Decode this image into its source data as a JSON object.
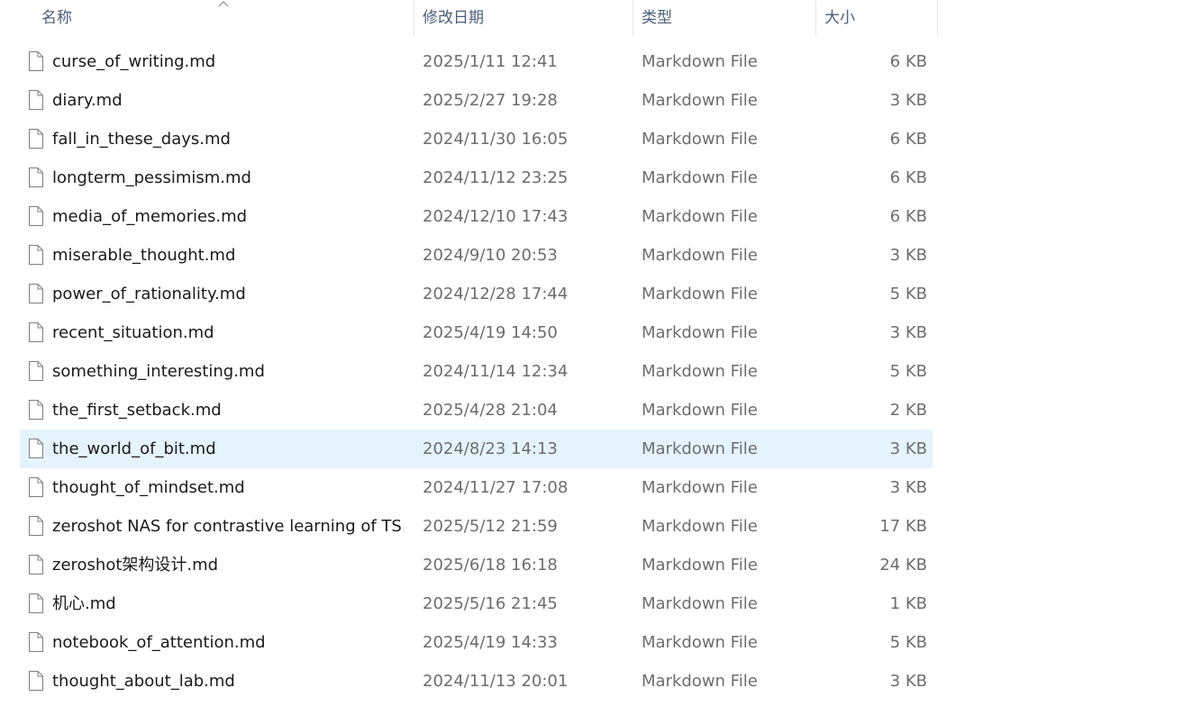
{
  "header": {
    "columns": [
      {
        "label": "名称"
      },
      {
        "label": "修改日期"
      },
      {
        "label": "类型"
      },
      {
        "label": "大小"
      }
    ],
    "sort_column": "名称",
    "sort_direction": "ascending"
  },
  "files": [
    {
      "name": "curse_of_writing.md",
      "date": "2025/1/11 12:41",
      "type": "Markdown File",
      "size": "6 KB",
      "icon": "document-icon"
    },
    {
      "name": "diary.md",
      "date": "2025/2/27 19:28",
      "type": "Markdown File",
      "size": "3 KB",
      "icon": "document-icon"
    },
    {
      "name": "fall_in_these_days.md",
      "date": "2024/11/30 16:05",
      "type": "Markdown File",
      "size": "6 KB",
      "icon": "document-icon"
    },
    {
      "name": "longterm_pessimism.md",
      "date": "2024/11/12 23:25",
      "type": "Markdown File",
      "size": "6 KB",
      "icon": "document-icon"
    },
    {
      "name": "media_of_memories.md",
      "date": "2024/12/10 17:43",
      "type": "Markdown File",
      "size": "6 KB",
      "icon": "document-icon"
    },
    {
      "name": "miserable_thought.md",
      "date": "2024/9/10 20:53",
      "type": "Markdown File",
      "size": "3 KB",
      "icon": "document-icon"
    },
    {
      "name": "power_of_rationality.md",
      "date": "2024/12/28 17:44",
      "type": "Markdown File",
      "size": "5 KB",
      "icon": "document-icon"
    },
    {
      "name": "recent_situation.md",
      "date": "2025/4/19 14:50",
      "type": "Markdown File",
      "size": "3 KB",
      "icon": "document-icon"
    },
    {
      "name": "something_interesting.md",
      "date": "2024/11/14 12:34",
      "type": "Markdown File",
      "size": "5 KB",
      "icon": "document-icon"
    },
    {
      "name": "the_first_setback.md",
      "date": "2025/4/28 21:04",
      "type": "Markdown File",
      "size": "2 KB",
      "icon": "document-icon"
    },
    {
      "name": "the_world_of_bit.md",
      "date": "2024/8/23 14:13",
      "type": "Markdown File",
      "size": "3 KB",
      "icon": "document-icon",
      "highlighted": true
    },
    {
      "name": "thought_of_mindset.md",
      "date": "2024/11/27 17:08",
      "type": "Markdown File",
      "size": "3 KB",
      "icon": "document-icon"
    },
    {
      "name": "zeroshot NAS for contrastive learning of TS....",
      "date": "2025/5/12 21:59",
      "type": "Markdown File",
      "size": "17 KB",
      "icon": "document-icon"
    },
    {
      "name": "zeroshot架构设计.md",
      "date": "2025/6/18 16:18",
      "type": "Markdown File",
      "size": "24 KB",
      "icon": "document-icon"
    },
    {
      "name": "机心.md",
      "date": "2025/5/16 21:45",
      "type": "Markdown File",
      "size": "1 KB",
      "icon": "document-icon"
    },
    {
      "name": "notebook_of_attention.md",
      "date": "2025/4/19 14:33",
      "type": "Markdown File",
      "size": "5 KB",
      "icon": "document-icon"
    },
    {
      "name": "thought_about_lab.md",
      "date": "2024/11/13 20:01",
      "type": "Markdown File",
      "size": "3 KB",
      "icon": "document-icon"
    }
  ],
  "colors": {
    "header_text": "#4c607a",
    "name_text": "#1a1a1a",
    "meta_text": "#6d6d6d",
    "highlight_bg": "#e5f3ff",
    "separator": "#e5e5e5"
  }
}
